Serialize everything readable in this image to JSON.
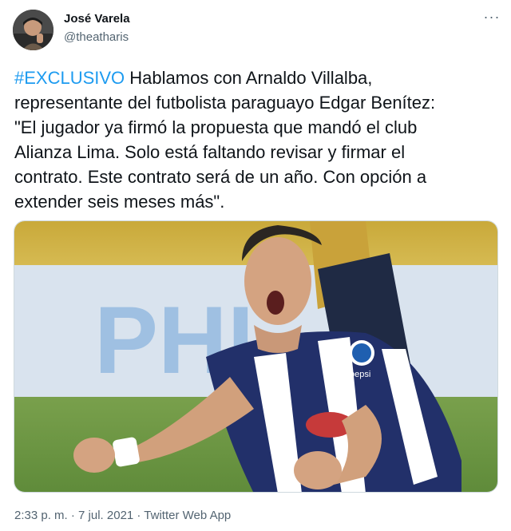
{
  "author": {
    "name": "José Varela",
    "handle": "@theatharis"
  },
  "more_label": "···",
  "tweet": {
    "hashtag": "#EXCLUSIVO",
    "body": " Hablamos con Arnaldo Villalba,\nrepresentante del futbolista paraguayo Edgar Benítez:\n\"El jugador ya firmó la propuesta que mandó el club\nAlianza Lima. Solo está faltando revisar y firmar el\ncontrato. Este contrato será de un año. Con opción a\nextender seis meses más\"."
  },
  "media": {
    "banner_text": "PHI",
    "shirt_text": "pepsi"
  },
  "meta": {
    "timestamp": "2:33 p. m. · 7 jul. 2021 · Twitter Web App"
  },
  "colors": {
    "link": "#1d9bf0",
    "secondary_text": "#536471",
    "primary_text": "#0f1419"
  }
}
